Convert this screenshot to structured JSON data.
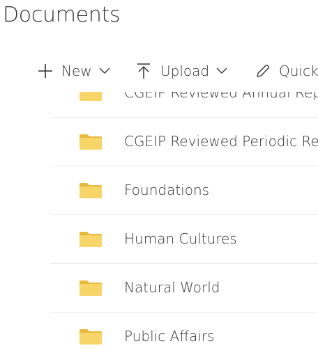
{
  "header": {
    "title": "Documents"
  },
  "toolbar": {
    "new_label": "New",
    "upload_label": "Upload",
    "quick_label": "Quick"
  },
  "files": [
    {
      "name": "CGEIP Reviewed Annual Rep",
      "icon": "folder-icon"
    },
    {
      "name": "CGEIP Reviewed Periodic Re",
      "icon": "folder-icon"
    },
    {
      "name": "Foundations",
      "icon": "folder-icon"
    },
    {
      "name": "Human Cultures",
      "icon": "folder-icon"
    },
    {
      "name": "Natural World",
      "icon": "folder-icon"
    },
    {
      "name": "Public Affairs",
      "icon": "folder-icon"
    }
  ],
  "colors": {
    "folder": "#f8d568",
    "folder_dark": "#e7b83c",
    "divider": "#edebe9"
  }
}
